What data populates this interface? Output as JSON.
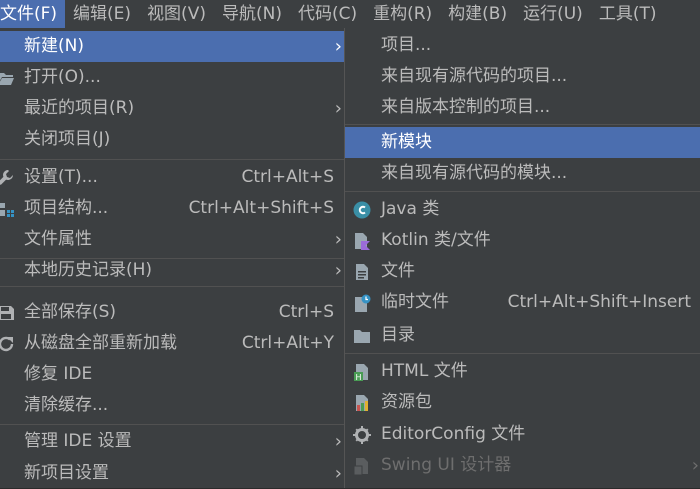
{
  "menubar": {
    "items": [
      "文件(F)",
      "编辑(E)",
      "视图(V)",
      "导航(N)",
      "代码(C)",
      "重构(R)",
      "构建(B)",
      "运行(U)",
      "工具(T)"
    ]
  },
  "file_menu": {
    "new": "新建(N)",
    "open": "打开(O)...",
    "recent": "最近的项目(R)",
    "close": "关闭项目(J)",
    "settings": "设置(T)...",
    "settings_shortcut": "Ctrl+Alt+S",
    "project_structure": "项目结构...",
    "project_structure_shortcut": "Ctrl+Alt+Shift+S",
    "file_properties": "文件属性",
    "local_history": "本地历史记录(H)",
    "save_all": "全部保存(S)",
    "save_all_shortcut": "Ctrl+S",
    "reload": "从磁盘全部重新加载",
    "reload_shortcut": "Ctrl+Alt+Y",
    "repair": "修复 IDE",
    "invalidate": "清除缓存...",
    "manage_ide": "管理 IDE 设置",
    "new_project_settings": "新项目设置"
  },
  "new_menu": {
    "project": "项目...",
    "project_existing": "来自现有源代码的项目...",
    "project_vcs": "来自版本控制的项目...",
    "module": "新模块",
    "module_existing": "来自现有源代码的模块...",
    "java_class": "Java 类",
    "kotlin": "Kotlin 类/文件",
    "file": "文件",
    "scratch": "临时文件",
    "scratch_shortcut": "Ctrl+Alt+Shift+Insert",
    "directory": "目录",
    "html": "HTML 文件",
    "resource_bundle": "资源包",
    "editorconfig": "EditorConfig 文件",
    "swing": "Swing UI 设计器"
  },
  "glyphs": {
    "submenu_arrow": "›"
  },
  "colors": {
    "selection": "#4b6eaf",
    "menu_bg": "#3c3f41",
    "text": "#bbbbbb",
    "disabled": "#6e6e6e"
  }
}
